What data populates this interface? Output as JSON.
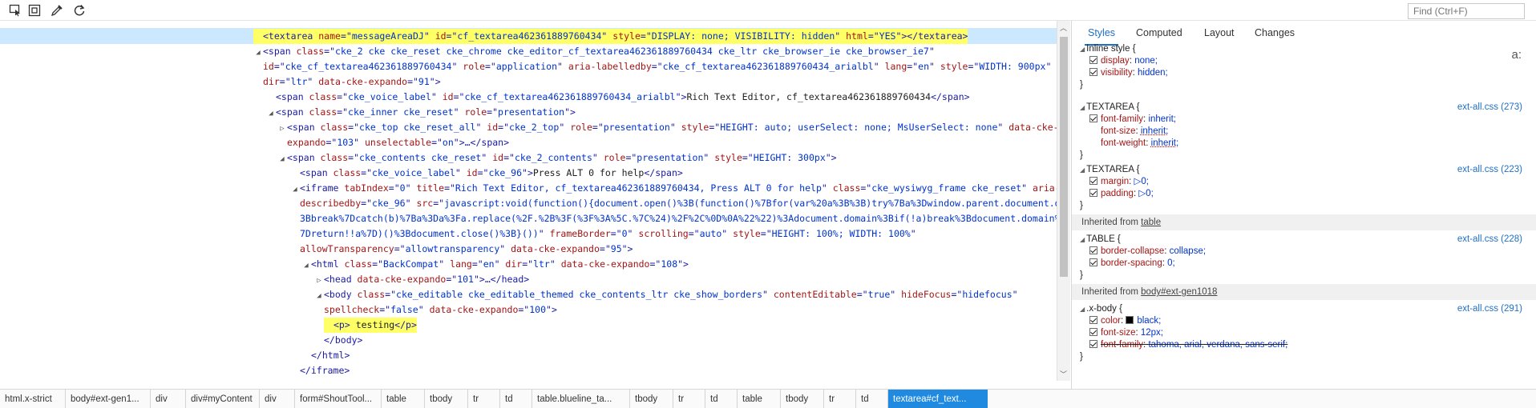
{
  "toolbar": {
    "tools": [
      {
        "name": "select-element-icon"
      },
      {
        "name": "dom-highlight-icon"
      },
      {
        "name": "color-picker-icon"
      },
      {
        "name": "refresh-icon"
      }
    ],
    "find_placeholder": "Find (Ctrl+F)"
  },
  "dom": {
    "lines": [
      {
        "tw": "",
        "hl": true,
        "parts": [
          [
            "tg",
            "<textarea "
          ],
          [
            "at",
            "name"
          ],
          [
            "tg",
            "=\""
          ],
          [
            "av",
            "messageAreaDJ"
          ],
          [
            "tg",
            "\" "
          ],
          [
            "at",
            "id"
          ],
          [
            "tg",
            "=\""
          ],
          [
            "av",
            "cf_textarea462361889760434"
          ],
          [
            "tg",
            "\" "
          ],
          [
            "at",
            "style"
          ],
          [
            "tg",
            "=\""
          ],
          [
            "av",
            "DISPLAY: none; VISIBILITY: hidden"
          ],
          [
            "tg",
            "\" "
          ],
          [
            "at",
            "html"
          ],
          [
            "tg",
            "=\""
          ],
          [
            "av",
            "YES"
          ],
          [
            "tg",
            "\"></textarea>"
          ]
        ]
      },
      {
        "tw": "◢",
        "parts": [
          [
            "tg",
            "<span "
          ],
          [
            "at",
            "class"
          ],
          [
            "tg",
            "=\""
          ],
          [
            "av",
            "cke_2 cke cke_reset cke_chrome cke_editor_cf_textarea462361889760434 cke_ltr cke_browser_ie cke_browser_ie7"
          ],
          [
            "tg",
            "\""
          ]
        ]
      },
      {
        "tw": "",
        "parts": [
          [
            "at",
            "id"
          ],
          [
            "tg",
            "=\""
          ],
          [
            "av",
            "cke_cf_textarea462361889760434"
          ],
          [
            "tg",
            "\" "
          ],
          [
            "at",
            "role"
          ],
          [
            "tg",
            "=\""
          ],
          [
            "av",
            "application"
          ],
          [
            "tg",
            "\" "
          ],
          [
            "at",
            "aria-labelledby"
          ],
          [
            "tg",
            "=\""
          ],
          [
            "av",
            "cke_cf_textarea462361889760434_arialbl"
          ],
          [
            "tg",
            "\" "
          ],
          [
            "at",
            "lang"
          ],
          [
            "tg",
            "=\""
          ],
          [
            "av",
            "en"
          ],
          [
            "tg",
            "\" "
          ],
          [
            "at",
            "style"
          ],
          [
            "tg",
            "=\""
          ],
          [
            "av",
            "WIDTH: 900px"
          ],
          [
            "tg",
            "\""
          ]
        ]
      },
      {
        "tw": "",
        "parts": [
          [
            "at",
            "dir"
          ],
          [
            "tg",
            "=\""
          ],
          [
            "av",
            "ltr"
          ],
          [
            "tg",
            "\" "
          ],
          [
            "at",
            "data-cke-expando"
          ],
          [
            "tg",
            "=\""
          ],
          [
            "av",
            "91"
          ],
          [
            "tg",
            "\">"
          ]
        ]
      },
      {
        "tw": "",
        "parts": [
          [
            "tg",
            "<span "
          ],
          [
            "at",
            "class"
          ],
          [
            "tg",
            "=\""
          ],
          [
            "av",
            "cke_voice_label"
          ],
          [
            "tg",
            "\" "
          ],
          [
            "at",
            "id"
          ],
          [
            "tg",
            "=\""
          ],
          [
            "av",
            "cke_cf_textarea462361889760434_arialbl"
          ],
          [
            "tg",
            "\">"
          ],
          [
            "tx",
            "Rich Text Editor, cf_textarea462361889760434"
          ],
          [
            "tg",
            "</span>"
          ]
        ]
      },
      {
        "tw": "◢",
        "parts": [
          [
            "tg",
            "<span "
          ],
          [
            "at",
            "class"
          ],
          [
            "tg",
            "=\""
          ],
          [
            "av",
            "cke_inner cke_reset"
          ],
          [
            "tg",
            "\" "
          ],
          [
            "at",
            "role"
          ],
          [
            "tg",
            "=\""
          ],
          [
            "av",
            "presentation"
          ],
          [
            "tg",
            "\">"
          ]
        ]
      },
      {
        "tw": "▷",
        "parts": [
          [
            "tg",
            "<span "
          ],
          [
            "at",
            "class"
          ],
          [
            "tg",
            "=\""
          ],
          [
            "av",
            "cke_top cke_reset_all"
          ],
          [
            "tg",
            "\" "
          ],
          [
            "at",
            "id"
          ],
          [
            "tg",
            "=\""
          ],
          [
            "av",
            "cke_2_top"
          ],
          [
            "tg",
            "\" "
          ],
          [
            "at",
            "role"
          ],
          [
            "tg",
            "=\""
          ],
          [
            "av",
            "presentation"
          ],
          [
            "tg",
            "\" "
          ],
          [
            "at",
            "style"
          ],
          [
            "tg",
            "=\""
          ],
          [
            "av",
            "HEIGHT: auto; userSelect: none; MsUserSelect: none"
          ],
          [
            "tg",
            "\" "
          ],
          [
            "at",
            "data-cke-"
          ]
        ]
      },
      {
        "tw": "",
        "parts": [
          [
            "at",
            "expando"
          ],
          [
            "tg",
            "=\""
          ],
          [
            "av",
            "103"
          ],
          [
            "tg",
            "\" "
          ],
          [
            "at",
            "unselectable"
          ],
          [
            "tg",
            "=\""
          ],
          [
            "av",
            "on"
          ],
          [
            "tg",
            "\">…</span>"
          ]
        ]
      },
      {
        "tw": "◢",
        "parts": [
          [
            "tg",
            "<span "
          ],
          [
            "at",
            "class"
          ],
          [
            "tg",
            "=\""
          ],
          [
            "av",
            "cke_contents cke_reset"
          ],
          [
            "tg",
            "\" "
          ],
          [
            "at",
            "id"
          ],
          [
            "tg",
            "=\""
          ],
          [
            "av",
            "cke_2_contents"
          ],
          [
            "tg",
            "\" "
          ],
          [
            "at",
            "role"
          ],
          [
            "tg",
            "=\""
          ],
          [
            "av",
            "presentation"
          ],
          [
            "tg",
            "\" "
          ],
          [
            "at",
            "style"
          ],
          [
            "tg",
            "=\""
          ],
          [
            "av",
            "HEIGHT: 300px"
          ],
          [
            "tg",
            "\">"
          ]
        ]
      },
      {
        "tw": "",
        "parts": [
          [
            "tg",
            "<span "
          ],
          [
            "at",
            "class"
          ],
          [
            "tg",
            "=\""
          ],
          [
            "av",
            "cke_voice_label"
          ],
          [
            "tg",
            "\" "
          ],
          [
            "at",
            "id"
          ],
          [
            "tg",
            "=\""
          ],
          [
            "av",
            "cke_96"
          ],
          [
            "tg",
            "\">"
          ],
          [
            "tx",
            "Press ALT 0 for help"
          ],
          [
            "tg",
            "</span>"
          ]
        ]
      },
      {
        "tw": "◢",
        "parts": [
          [
            "tg",
            "<iframe "
          ],
          [
            "at",
            "tabIndex"
          ],
          [
            "tg",
            "=\""
          ],
          [
            "av",
            "0"
          ],
          [
            "tg",
            "\" "
          ],
          [
            "at",
            "title"
          ],
          [
            "tg",
            "=\""
          ],
          [
            "av",
            "Rich Text Editor, cf_textarea462361889760434, Press ALT 0 for help"
          ],
          [
            "tg",
            "\" "
          ],
          [
            "at",
            "class"
          ],
          [
            "tg",
            "=\""
          ],
          [
            "av",
            "cke_wysiwyg_frame cke_reset"
          ],
          [
            "tg",
            "\" "
          ],
          [
            "at",
            "aria-"
          ]
        ]
      },
      {
        "tw": "",
        "parts": [
          [
            "at",
            "describedby"
          ],
          [
            "tg",
            "=\""
          ],
          [
            "av",
            "cke_96"
          ],
          [
            "tg",
            "\" "
          ],
          [
            "at",
            "src"
          ],
          [
            "tg",
            "=\""
          ],
          [
            "av",
            "javascript:void(function(){document.open()%3B(function()%7Bfor(var%20a%3B%3B)try%7Ba%3Dwindow.parent.document.domain%"
          ]
        ]
      },
      {
        "tw": "",
        "parts": [
          [
            "av",
            "3Bbreak%7Dcatch(b)%7Ba%3Da%3Fa.replace(%2F.%2B%3F(%3F%3A%5C.%7C%24)%2F%2C%0D%0A%22%22)%3Adocument.domain%3Bif(!a)break%3Bdocument.domain%3Da%"
          ]
        ]
      },
      {
        "tw": "",
        "parts": [
          [
            "av",
            "7Dreturn!!a%7D)()%3Bdocument.close()%3B}())"
          ],
          [
            "tg",
            "\" "
          ],
          [
            "at",
            "frameBorder"
          ],
          [
            "tg",
            "=\""
          ],
          [
            "av",
            "0"
          ],
          [
            "tg",
            "\" "
          ],
          [
            "at",
            "scrolling"
          ],
          [
            "tg",
            "=\""
          ],
          [
            "av",
            "auto"
          ],
          [
            "tg",
            "\" "
          ],
          [
            "at",
            "style"
          ],
          [
            "tg",
            "=\""
          ],
          [
            "av",
            "HEIGHT: 100%; WIDTH: 100%"
          ],
          [
            "tg",
            "\""
          ]
        ]
      },
      {
        "tw": "",
        "parts": [
          [
            "at",
            "allowTransparency"
          ],
          [
            "tg",
            "=\""
          ],
          [
            "av",
            "allowtransparency"
          ],
          [
            "tg",
            "\" "
          ],
          [
            "at",
            "data-cke-expando"
          ],
          [
            "tg",
            "=\""
          ],
          [
            "av",
            "95"
          ],
          [
            "tg",
            "\">"
          ]
        ]
      },
      {
        "tw": "◢",
        "parts": [
          [
            "tg",
            "<html "
          ],
          [
            "at",
            "class"
          ],
          [
            "tg",
            "=\""
          ],
          [
            "av",
            "BackCompat"
          ],
          [
            "tg",
            "\" "
          ],
          [
            "at",
            "lang"
          ],
          [
            "tg",
            "=\""
          ],
          [
            "av",
            "en"
          ],
          [
            "tg",
            "\" "
          ],
          [
            "at",
            "dir"
          ],
          [
            "tg",
            "=\""
          ],
          [
            "av",
            "ltr"
          ],
          [
            "tg",
            "\" "
          ],
          [
            "at",
            "data-cke-expando"
          ],
          [
            "tg",
            "=\""
          ],
          [
            "av",
            "108"
          ],
          [
            "tg",
            "\">"
          ]
        ]
      },
      {
        "tw": "▷",
        "parts": [
          [
            "tg",
            "<head "
          ],
          [
            "at",
            "data-cke-expando"
          ],
          [
            "tg",
            "=\""
          ],
          [
            "av",
            "101"
          ],
          [
            "tg",
            "\">…</head>"
          ]
        ]
      },
      {
        "tw": "◢",
        "parts": [
          [
            "tg",
            "<body "
          ],
          [
            "at",
            "class"
          ],
          [
            "tg",
            "=\""
          ],
          [
            "av",
            "cke_editable cke_editable_themed cke_contents_ltr cke_show_borders"
          ],
          [
            "tg",
            "\" "
          ],
          [
            "at",
            "contentEditable"
          ],
          [
            "tg",
            "=\""
          ],
          [
            "av",
            "true"
          ],
          [
            "tg",
            "\" "
          ],
          [
            "at",
            "hideFocus"
          ],
          [
            "tg",
            "=\""
          ],
          [
            "av",
            "hidefocus"
          ],
          [
            "tg",
            "\""
          ]
        ]
      },
      {
        "tw": "",
        "parts": [
          [
            "at",
            "spellcheck"
          ],
          [
            "tg",
            "=\""
          ],
          [
            "av",
            "false"
          ],
          [
            "tg",
            "\" "
          ],
          [
            "at",
            "data-cke-expando"
          ],
          [
            "tg",
            "=\""
          ],
          [
            "av",
            "100"
          ],
          [
            "tg",
            "\">"
          ]
        ]
      },
      {
        "tw": "",
        "hl": true,
        "parts": [
          [
            "tg",
            "<p>"
          ],
          [
            "tx",
            " testing"
          ],
          [
            "tg",
            "</p>"
          ]
        ]
      },
      {
        "tw": "",
        "parts": [
          [
            "tg",
            "</body>"
          ]
        ]
      },
      {
        "tw": "",
        "parts": [
          [
            "tg",
            "</html>"
          ]
        ]
      },
      {
        "tw": "",
        "parts": [
          [
            "tg",
            "</iframe>"
          ]
        ]
      },
      {
        "tw": "",
        "parts": [
          [
            "tg",
            "</span>"
          ]
        ]
      }
    ]
  },
  "styles": {
    "tabs": [
      "Styles",
      "Computed",
      "Layout",
      "Changes"
    ],
    "az_label": "a:",
    "lines": [
      {
        "kind": "rule",
        "selector": "Inline style",
        "source": ""
      },
      {
        "kind": "prop",
        "name": "display",
        "value": "none;",
        "checked": true
      },
      {
        "kind": "prop",
        "name": "visibility",
        "value": "hidden;",
        "checked": true
      },
      {
        "kind": "close"
      },
      {
        "kind": "gap"
      },
      {
        "kind": "rule",
        "selector": "TEXTAREA",
        "source": "ext-all.css (273)"
      },
      {
        "kind": "prop",
        "name": "font-family",
        "value": "inherit;",
        "checked": true
      },
      {
        "kind": "prop",
        "name": "font-size",
        "value": "inherit;",
        "checked": false,
        "dotted": true
      },
      {
        "kind": "prop",
        "name": "font-weight",
        "value": "inherit;",
        "checked": false,
        "dotted": true
      },
      {
        "kind": "close"
      },
      {
        "kind": "rule",
        "selector": "TEXTAREA",
        "source": "ext-all.css (223)"
      },
      {
        "kind": "prop",
        "name": "margin",
        "value": "▷0;",
        "checked": true
      },
      {
        "kind": "prop",
        "name": "padding",
        "value": "▷0;",
        "checked": true
      },
      {
        "kind": "close"
      },
      {
        "kind": "inherit",
        "prefix": "Inherited from ",
        "link": "table"
      },
      {
        "kind": "rule",
        "selector": "TABLE",
        "source": "ext-all.css (228)"
      },
      {
        "kind": "prop",
        "name": "border-collapse",
        "value": "collapse;",
        "checked": true
      },
      {
        "kind": "prop",
        "name": "border-spacing",
        "value": "0;",
        "checked": true
      },
      {
        "kind": "close"
      },
      {
        "kind": "inherit",
        "prefix": "Inherited from ",
        "link": "body#ext-gen1018"
      },
      {
        "kind": "rule",
        "selector": ".x-body",
        "source": "ext-all.css (291)"
      },
      {
        "kind": "prop",
        "name": "color",
        "value": "black;",
        "checked": true,
        "swatch": "#000000"
      },
      {
        "kind": "prop",
        "name": "font-size",
        "value": "12px;",
        "checked": true
      },
      {
        "kind": "prop",
        "name": "font-family",
        "value": "tahoma, arial, verdana, sans-serif;",
        "checked": true,
        "strike": true
      },
      {
        "kind": "close"
      }
    ]
  },
  "breadcrumb": {
    "items": [
      "html.x-strict",
      "body#ext-gen1...",
      "div",
      "div#myContent",
      "div",
      "form#ShoutTool...",
      "table",
      "tbody",
      "tr",
      "td",
      "table.blueline_ta...",
      "tbody",
      "tr",
      "td",
      "table",
      "tbody",
      "tr",
      "td",
      "textarea#cf_text..."
    ]
  }
}
